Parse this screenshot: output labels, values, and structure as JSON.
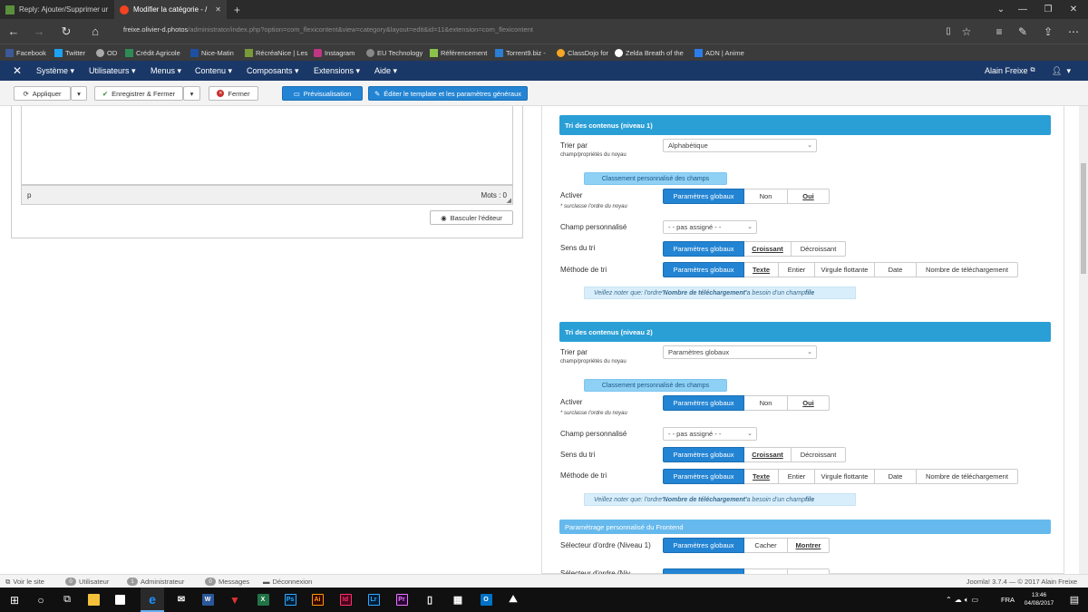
{
  "browser": {
    "tabs": [
      {
        "title": "Reply: Ajouter/Supprimer ur",
        "icon": "forum-favicon"
      },
      {
        "title": "Modifier la catégorie - /",
        "icon": "joomla-favicon"
      }
    ],
    "new_tab_glyph": "+",
    "url_host": "freixe.olivier-d.photos",
    "url_path": "/administrator/index.php?option=com_flexicontent&view=category&layout=edit&id=11&extension=com_flexicontent",
    "favorites": [
      {
        "label": "Facebook",
        "icon": "facebook-icon",
        "color": "#3b5998"
      },
      {
        "label": "Twitter",
        "icon": "twitter-icon",
        "color": "#1da1f2"
      },
      {
        "label": "OD",
        "icon": "od-icon",
        "color": "#aaaaaa"
      },
      {
        "label": "Crédit Agricole",
        "icon": "credit-agricole-icon",
        "color": "#2e8b57"
      },
      {
        "label": "Nice-Matin",
        "icon": "nice-matin-icon",
        "color": "#1f4fa3"
      },
      {
        "label": "RécréaNice | Les",
        "icon": "recreanice-icon",
        "color": "#7a9a3a"
      },
      {
        "label": "Instagram",
        "icon": "instagram-icon",
        "color": "#c13584"
      },
      {
        "label": "EU Technology",
        "icon": "eu-technology-icon",
        "color": "#888888"
      },
      {
        "label": "Référencement",
        "icon": "referencement-icon",
        "color": "#8bc34a"
      },
      {
        "label": "Torrent9.biz -",
        "icon": "torrent9-icon",
        "color": "#2a7fd4"
      },
      {
        "label": "ClassDojo for",
        "icon": "classdojo-icon",
        "color": "#f5a623"
      },
      {
        "label": "Zelda Breath of the",
        "icon": "zelda-icon",
        "color": "#111111"
      },
      {
        "label": "ADN | Anime",
        "icon": "adn-icon",
        "color": "#2b7de9"
      }
    ]
  },
  "joomla_menu": {
    "items": [
      "Système ▾",
      "Utilisateurs ▾",
      "Menus ▾",
      "Contenu ▾",
      "Composants ▾",
      "Extensions ▾",
      "Aide ▾"
    ],
    "user": "Alain Freixe",
    "user_caret": "▾"
  },
  "toolbar": {
    "apply": "Appliquer",
    "save_close": "Enregistrer & Fermer",
    "close": "Fermer",
    "preview": "Prévisualisation",
    "edit_template": "Éditer le template et les paramètres généraux"
  },
  "editor": {
    "path": "p",
    "word_count": "Mots : 0",
    "toggle_label": "Basculer l'éditeur"
  },
  "sections": [
    {
      "title": "Tri des contenus (niveau 1)",
      "sort_label": "Trier par",
      "sort_sub": "champ/propriétés du noyau",
      "sort_value": "Alphabétique",
      "custom_chip": "Classement personnalisé des champs",
      "activate_label": "Activer",
      "activate_sub": "* surclasse l'ordre du noyau",
      "activate_options": [
        "Paramètres globaux",
        "Non",
        "Oui"
      ],
      "custom_field_label": "Champ personnalisé",
      "custom_field_value": "- - pas assigné - -",
      "direction_label": "Sens du tri",
      "direction_options": [
        "Paramètres globaux",
        "Croissant",
        "Décroissant"
      ],
      "method_label": "Méthode de tri",
      "method_options": [
        "Paramètres globaux",
        "Texte",
        "Entier",
        "Virgule flottante",
        "Date",
        "Nombre de téléchargement"
      ],
      "note_prefix": "Veillez noter que: l'ordre ",
      "note_bold": "'Nombre de téléchargement'",
      "note_mid": " a besoin d'un champ ",
      "note_end": "file"
    },
    {
      "title": "Tri des contenus (niveau 2)",
      "sort_label": "Trier par",
      "sort_sub": "champ/propriétés du noyau",
      "sort_value": "Paramètres globaux",
      "custom_chip": "Classement personnalisé des champs",
      "activate_label": "Activer",
      "activate_sub": "* surclasse l'ordre du noyau",
      "activate_options": [
        "Paramètres globaux",
        "Non",
        "Oui"
      ],
      "custom_field_label": "Champ personnalisé",
      "custom_field_value": "- - pas assigné - -",
      "direction_label": "Sens du tri",
      "direction_options": [
        "Paramètres globaux",
        "Croissant",
        "Décroissant"
      ],
      "method_label": "Méthode de tri",
      "method_options": [
        "Paramètres globaux",
        "Texte",
        "Entier",
        "Virgule flottante",
        "Date",
        "Nombre de téléchargement"
      ],
      "note_prefix": "Veillez noter que: l'ordre ",
      "note_bold": "'Nombre de téléchargement'",
      "note_mid": " a besoin d'un champ ",
      "note_end": "file"
    }
  ],
  "frontend": {
    "title": "Paramétrage personnalisé du Frontend",
    "selector_label": "Sélecteur d'ordre (Niveau 1)",
    "selector_options": [
      "Paramètres globaux",
      "Cacher",
      "Montrer"
    ],
    "selector2_label": "Sélecteur d'ordre (Niv"
  },
  "status": {
    "view_site": "Voir le site",
    "users_count": "0",
    "users_label": "Utilisateur",
    "admin_count": "1",
    "admin_label": "Administrateur",
    "messages_count": "0",
    "messages_label": "Messages",
    "logout": "Déconnexion",
    "version": "Joomla! 3.7.4 — © 2017 Alain Freixe"
  },
  "taskbar": {
    "apps": [
      {
        "icon": "edge-icon",
        "color": "#1e90ff"
      },
      {
        "icon": "mail-icon",
        "color": "#ffffff"
      },
      {
        "icon": "word-icon",
        "color": "#2b579a",
        "glyph": "W"
      },
      {
        "icon": "vivaldi-icon",
        "color": "#d33"
      },
      {
        "icon": "excel-icon",
        "color": "#217346",
        "glyph": "X"
      },
      {
        "icon": "photoshop-icon",
        "color": "#001d34",
        "glyph": "Ps"
      },
      {
        "icon": "illustrator-icon",
        "color": "#330000",
        "glyph": "Ai"
      },
      {
        "icon": "indesign-icon",
        "color": "#49021f",
        "glyph": "Id"
      },
      {
        "icon": "lightroom-icon",
        "color": "#001d34",
        "glyph": "Lr"
      },
      {
        "icon": "premiere-icon",
        "color": "#2a0634",
        "glyph": "Pr"
      },
      {
        "icon": "tablet-icon",
        "color": "#ffffff"
      },
      {
        "icon": "calculator-icon",
        "color": "#ffffff"
      },
      {
        "icon": "outlook-icon",
        "color": "#0072c6",
        "glyph": "O"
      },
      {
        "icon": "photos-icon",
        "color": "#ffffff"
      }
    ],
    "lang": "FRA",
    "time": "13:46",
    "date": "04/08/2017"
  },
  "colors": {
    "accent": "#2384d3",
    "section": "#2a9fd6",
    "joomla_nav": "#1a3867"
  }
}
